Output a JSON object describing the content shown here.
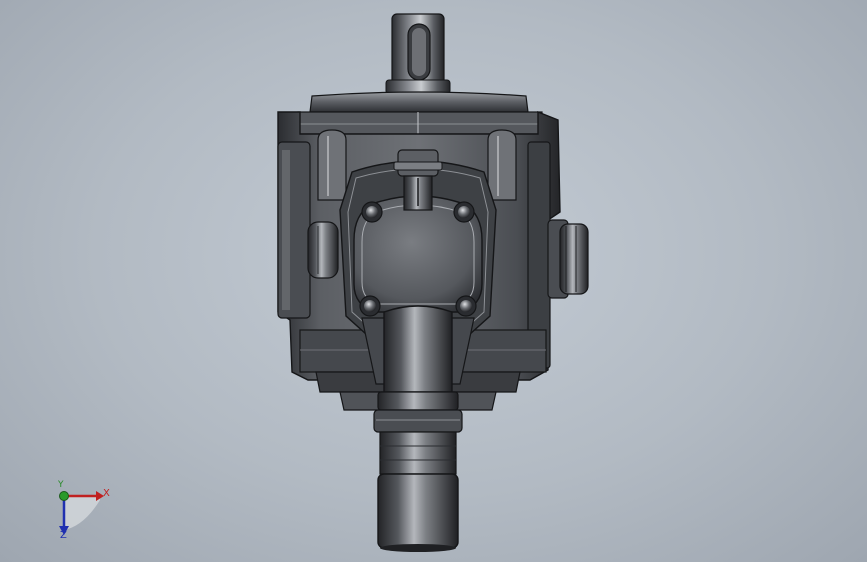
{
  "view": {
    "background_top": "#c3cbd4",
    "background_bottom": "#9ea6b0",
    "model_base_color": "#4a4d52",
    "model_highlight_color": "#d8dadd",
    "model_shadow_color": "#1c1d20"
  },
  "triad": {
    "x_label": "X",
    "y_label": "Y",
    "z_label": "Z",
    "x_color": "#c02020",
    "y_color": "#2a8a2a",
    "z_color": "#2030b0"
  },
  "icons": {
    "model": "3d-pump-model",
    "triad": "coordinate-triad-icon"
  }
}
